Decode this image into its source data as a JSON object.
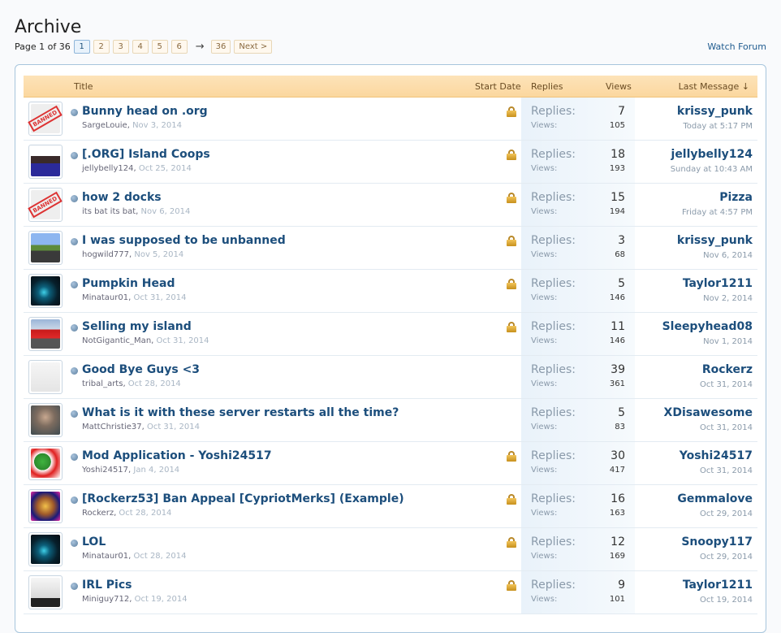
{
  "page": {
    "title": "Archive"
  },
  "pagination": {
    "label": "Page 1 of 36",
    "pages": [
      "1",
      "2",
      "3",
      "4",
      "5",
      "6"
    ],
    "current": "1",
    "arrow": "→",
    "last_page": "36",
    "next": "Next >"
  },
  "watch_forum": "Watch Forum",
  "columns": {
    "title": "Title",
    "start_date": "Start Date",
    "replies": "Replies",
    "views": "Views",
    "last_message": "Last Message ↓"
  },
  "labels": {
    "replies": "Replies:",
    "views": "Views:"
  },
  "threads": [
    {
      "avatar": "banned-avatar",
      "title": "Bunny head on .org",
      "author": "SargeLouie",
      "date": "Nov 3, 2014",
      "locked": true,
      "replies": "7",
      "views": "105",
      "last_user": "krissy_punk",
      "last_time": "Today at 5:17 PM"
    },
    {
      "avatar": "anime-avatar",
      "title": "[.ORG] Island Coops",
      "author": "jellybelly124",
      "date": "Oct 25, 2014",
      "locked": true,
      "replies": "18",
      "views": "193",
      "last_user": "jellybelly124",
      "last_time": "Sunday at 10:43 AM"
    },
    {
      "avatar": "banned-avatar",
      "title": "how 2 docks",
      "author": "its bat its bat",
      "date": "Nov 6, 2014",
      "locked": true,
      "replies": "15",
      "views": "194",
      "last_user": "Pizza",
      "last_time": "Friday at 4:57 PM"
    },
    {
      "avatar": "minecraft-avatar",
      "title": "I was supposed to be unbanned",
      "author": "hogwild777",
      "date": "Nov 5, 2014",
      "locked": true,
      "replies": "3",
      "views": "68",
      "last_user": "krissy_punk",
      "last_time": "Nov 6, 2014"
    },
    {
      "avatar": "space-avatar",
      "title": "Pumpkin Head",
      "author": "Minataur01",
      "date": "Oct 31, 2014",
      "locked": true,
      "replies": "5",
      "views": "146",
      "last_user": "Taylor1211",
      "last_time": "Nov 2, 2014"
    },
    {
      "avatar": "car-avatar",
      "title": "Selling my island",
      "author": "NotGigantic_Man",
      "date": "Oct 31, 2014",
      "locked": true,
      "replies": "11",
      "views": "146",
      "last_user": "Sleepyhead08",
      "last_time": "Nov 1, 2014"
    },
    {
      "avatar": "sketch-avatar",
      "title": "Good Bye Guys <3",
      "author": "tribal_arts",
      "date": "Oct 28, 2014",
      "locked": false,
      "replies": "39",
      "views": "361",
      "last_user": "Rockerz",
      "last_time": "Oct 31, 2014"
    },
    {
      "avatar": "photo-avatar",
      "title": "What is it with these server restarts all the time?",
      "author": "MattChristie37",
      "date": "Oct 31, 2014",
      "locked": false,
      "replies": "5",
      "views": "83",
      "last_user": "XDisawesome",
      "last_time": "Oct 31, 2014"
    },
    {
      "avatar": "yoshi-avatar",
      "title": "Mod Application - Yoshi24517",
      "author": "Yoshi24517",
      "date": "Jan 4, 2014",
      "locked": true,
      "replies": "30",
      "views": "417",
      "last_user": "Yoshi24517",
      "last_time": "Oct 31, 2014"
    },
    {
      "avatar": "clown-avatar",
      "title": "[Rockerz53] Ban Appeal [CypriotMerks] (Example)",
      "author": "Rockerz",
      "date": "Oct 28, 2014",
      "locked": true,
      "replies": "16",
      "views": "163",
      "last_user": "Gemmalove",
      "last_time": "Oct 29, 2014"
    },
    {
      "avatar": "space-avatar",
      "title": "LOL",
      "author": "Minataur01",
      "date": "Oct 28, 2014",
      "locked": true,
      "replies": "12",
      "views": "169",
      "last_user": "Snoopy117",
      "last_time": "Oct 29, 2014"
    },
    {
      "avatar": "army-avatar",
      "title": "IRL Pics",
      "author": "Miniguy712",
      "date": "Oct 19, 2014",
      "locked": true,
      "replies": "9",
      "views": "101",
      "last_user": "Taylor1211",
      "last_time": "Oct 19, 2014"
    }
  ],
  "banned_stamp": "BANNED"
}
